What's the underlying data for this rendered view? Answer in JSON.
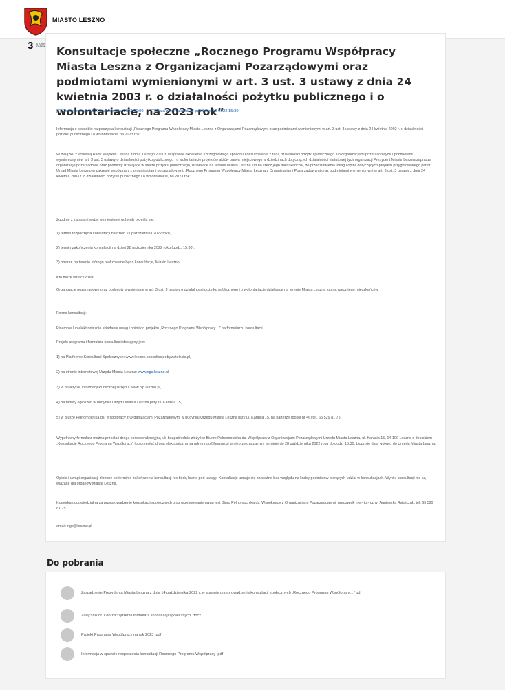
{
  "site": {
    "brand": "MIASTO LESZNO",
    "access_number": "3",
    "access_label": "STOPNIA ZAPEWNIENIA"
  },
  "article": {
    "title": "Konsultacje społeczne „Rocznego Programu Współpracy Miasta Leszna z Organizacjami Pozarządowymi oraz podmiotami wymienionymi w art. 3 ust. 3 ustawy z dnia 24 kwietnia 2003 r. o działalności pożytku publicznego i o wolontariacie, na 2023 rok”",
    "date_start": "Data rozpoczęcia 21 października 2022 00:00",
    "date_end": "Data zakończenia 28 października 2022 15:30",
    "paragraphs": [
      "Informacja o sposobie rozpoczęcia konsultacji „Rocznego Programu Współpracy Miasta Leszna z Organizacjami Pozarządowymi oraz podmiotami wymienionymi w art. 3 ust. 3 ustawy z dnia 24 kwietnia 2003 r. o działalności pożytku publicznego i o wolontariacie, na 2023 rok”",
      "W związku z uchwałą Rady Miejskiej Leszna z dnia 1 lutego 2011 r. w sprawie określenia szczegółowego sposobu konsultowania z radą działalności pożytku publicznego lub organizacjami pozarządowymi i podmiotami wymienionymi w art. 3 ust. 3 ustawy o działalności pożytku publicznego i o wolontariacie projektów aktów prawa miejscowego w dziedzinach dotyczących działalności statutowej tych organizacji Prezydent Miasta Leszna zaprasza organizacje pozarządowe oraz podmioty działające w sferze pożytku publicznego, działające na terenie Miasta Leszna lub na rzecz jego mieszkańców, do przedstawienia uwag i opinii dotyczących projektu przygotowanego przez Urząd Miasta Leszno w zakresie współpracy z organizacjami pozarządowymi, „Rocznego Programu Współpracy Miasta Leszna z Organizacjami Pozarządowymi oraz podmiotami wymienionymi w art. 3 ust. 3 ustawy z dnia 24 kwietnia 2003 r. o działalności pożytku publicznego i o wolontariacie, na 2023 rok”",
      "Zgodnie z zapisami wyżej wymienionej uchwały określa się:",
      "1) termin rozpoczęcia konsultacji na dzień 21 października 2022 roku,",
      "2) termin zakończenia konsultacji na dzień 28 października 2022 roku (godz. 15:30),",
      "3) obszar, na terenie którego realizowane będą konsultacje, Miasto Leszno.",
      "Kto może wziąć udział:",
      "Organizacje pozarządowe oraz podmioty wymienione w art. 3 ust. 3 ustawy o działalności pożytku publicznego i o wolontariacie działające na terenie Miasta Leszna lub na rzecz jego mieszkańców.",
      "Forma konsultacji:",
      "Pisemnie lub elektronicznie składanie uwag i opinii do projektu „Rocznego Programu Współpracy…” na formularzu konsultacji.",
      "Projekt programu i formularz konsultacji dostępny jest:",
      "1) na Platformie Konsultacji Społecznych: www.leszno.konsultacjeobywatelskie.pl,",
      "2) na stronie internetowej Urzędu Miasta Leszna:",
      "3) w Biuletynie Informacji Publicznej Urzędu: www.bip.leszno.pl,",
      "4) na tablicy ogłoszeń w budynku Urzędu Miasta Leszna przy ul. Karasia 15,",
      "5) w Biurze Pełnomocnika ds. Współpracy z Organizacjami Pozarządowymi w budynku Urzędu Miasta Leszna przy ul. Karasia 15, na parterze (pokój nr 46) tel. 65 529 81 75.",
      "Wypełniony formularz można przesłać drogą korespondencyjną lub bezpośrednio złożyć w Biurze Pełnomocnika ds. Współpracy z Organizacjami Pozarządowymi Urzędu Miasta Leszna, ul. Karasia 15, 64-100 Leszno z dopiskiem „Konsultacje Rocznego Programu Współpracy” lub przesłać drogą elektroniczną na adres ngo@leszno.pl w nieprzekraczalnym terminie do 28 października 2022 roku do godz. 15:30. Liczy się data wpływu do Urzędu Miasta Leszna.",
      "Opinie i uwagi organizacji złożone po terminie zakończenia konsultacji nie będą brane pod uwagę. Konsultacje uznaje się za ważne bez względu na liczbę podmiotów biorących udział w konsultacjach. Wyniki konsultacji nie są wiążące dla organów Miasta Leszna.",
      "Komórką odpowiedzialną za przeprowadzenie konsultacji społecznych oraz przyjmowanie uwag jest Biuro Pełnomocnika ds. Współpracy z Organizacjami Pozarządowymi, pracownik merytoryczny: Agnieszka Ratajczak, tel. 65 529 81 75.",
      "email: ngo@leszno.pl"
    ],
    "link_text": "www.ngo.leszno.pl"
  },
  "downloads": {
    "heading": "Do pobrania",
    "items": [
      "Zarządzenie Prezydenta Miasta Leszna z dnia 14 października 2022 r. w sprawie przeprowadzenia konsultacji społecznych „Rocznego Programu Współpracy…” pdf",
      "Załącznik nr 1 do zarządzenia formularz konsultacji społecznych .docx",
      "Projekt Programu Współpracy na rok 2023 .pdf",
      "Informacja w sprawie rozpoczęcia konsultacji Rocznego Programu Współpracy .pdf"
    ]
  }
}
